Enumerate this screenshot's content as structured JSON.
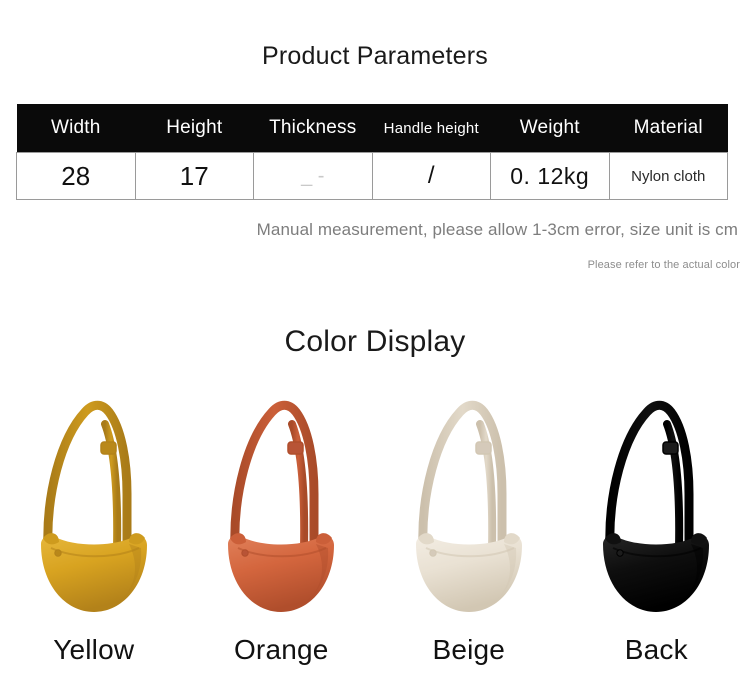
{
  "sections": {
    "parameters_title": "Product Parameters",
    "color_title": "Color Display"
  },
  "table": {
    "headers": [
      {
        "label": "Width",
        "size": "normal"
      },
      {
        "label": "Height",
        "size": "normal"
      },
      {
        "label": "Thickness",
        "size": "normal"
      },
      {
        "label": "Handle height",
        "size": "small"
      },
      {
        "label": "Weight",
        "size": "normal"
      },
      {
        "label": "Material",
        "size": "normal"
      }
    ],
    "row": {
      "width": "28",
      "height": "17",
      "thickness": "_ -",
      "handle_height": "/",
      "weight": "0. 12kg",
      "material": "Nylon cloth"
    },
    "header_background": "#0a0a0a",
    "header_text_color": "#ffffff",
    "border_color": "#9a9a9a"
  },
  "notes": {
    "measurement": "Manual measurement, please allow 1-3cm error, size unit is cm",
    "color_disclaimer": "Please refer to the actual color"
  },
  "colors": [
    {
      "label": "Yellow",
      "body": "#D8A320",
      "body_dark": "#B3821A",
      "body_light": "#E6B73C",
      "strap": "#CE9B1E",
      "strap_dark": "#A97B18",
      "hardware": "#B9881A"
    },
    {
      "label": "Orange",
      "body": "#D4663E",
      "body_dark": "#B04E2C",
      "body_light": "#E0805A",
      "strap": "#CB5F39",
      "strap_dark": "#A94B29",
      "hardware": "#B85436"
    },
    {
      "label": "Beige",
      "body": "#E9E1D3",
      "body_dark": "#D2C7B3",
      "body_light": "#F3EDE3",
      "strap": "#E2D9C9",
      "strap_dark": "#CCC0AC",
      "hardware": "#D5CABA"
    },
    {
      "label": "Back",
      "body": "#0E0E0E",
      "body_dark": "#000000",
      "body_light": "#262626",
      "strap": "#101010",
      "strap_dark": "#000000",
      "hardware": "#1c1c1c"
    }
  ]
}
